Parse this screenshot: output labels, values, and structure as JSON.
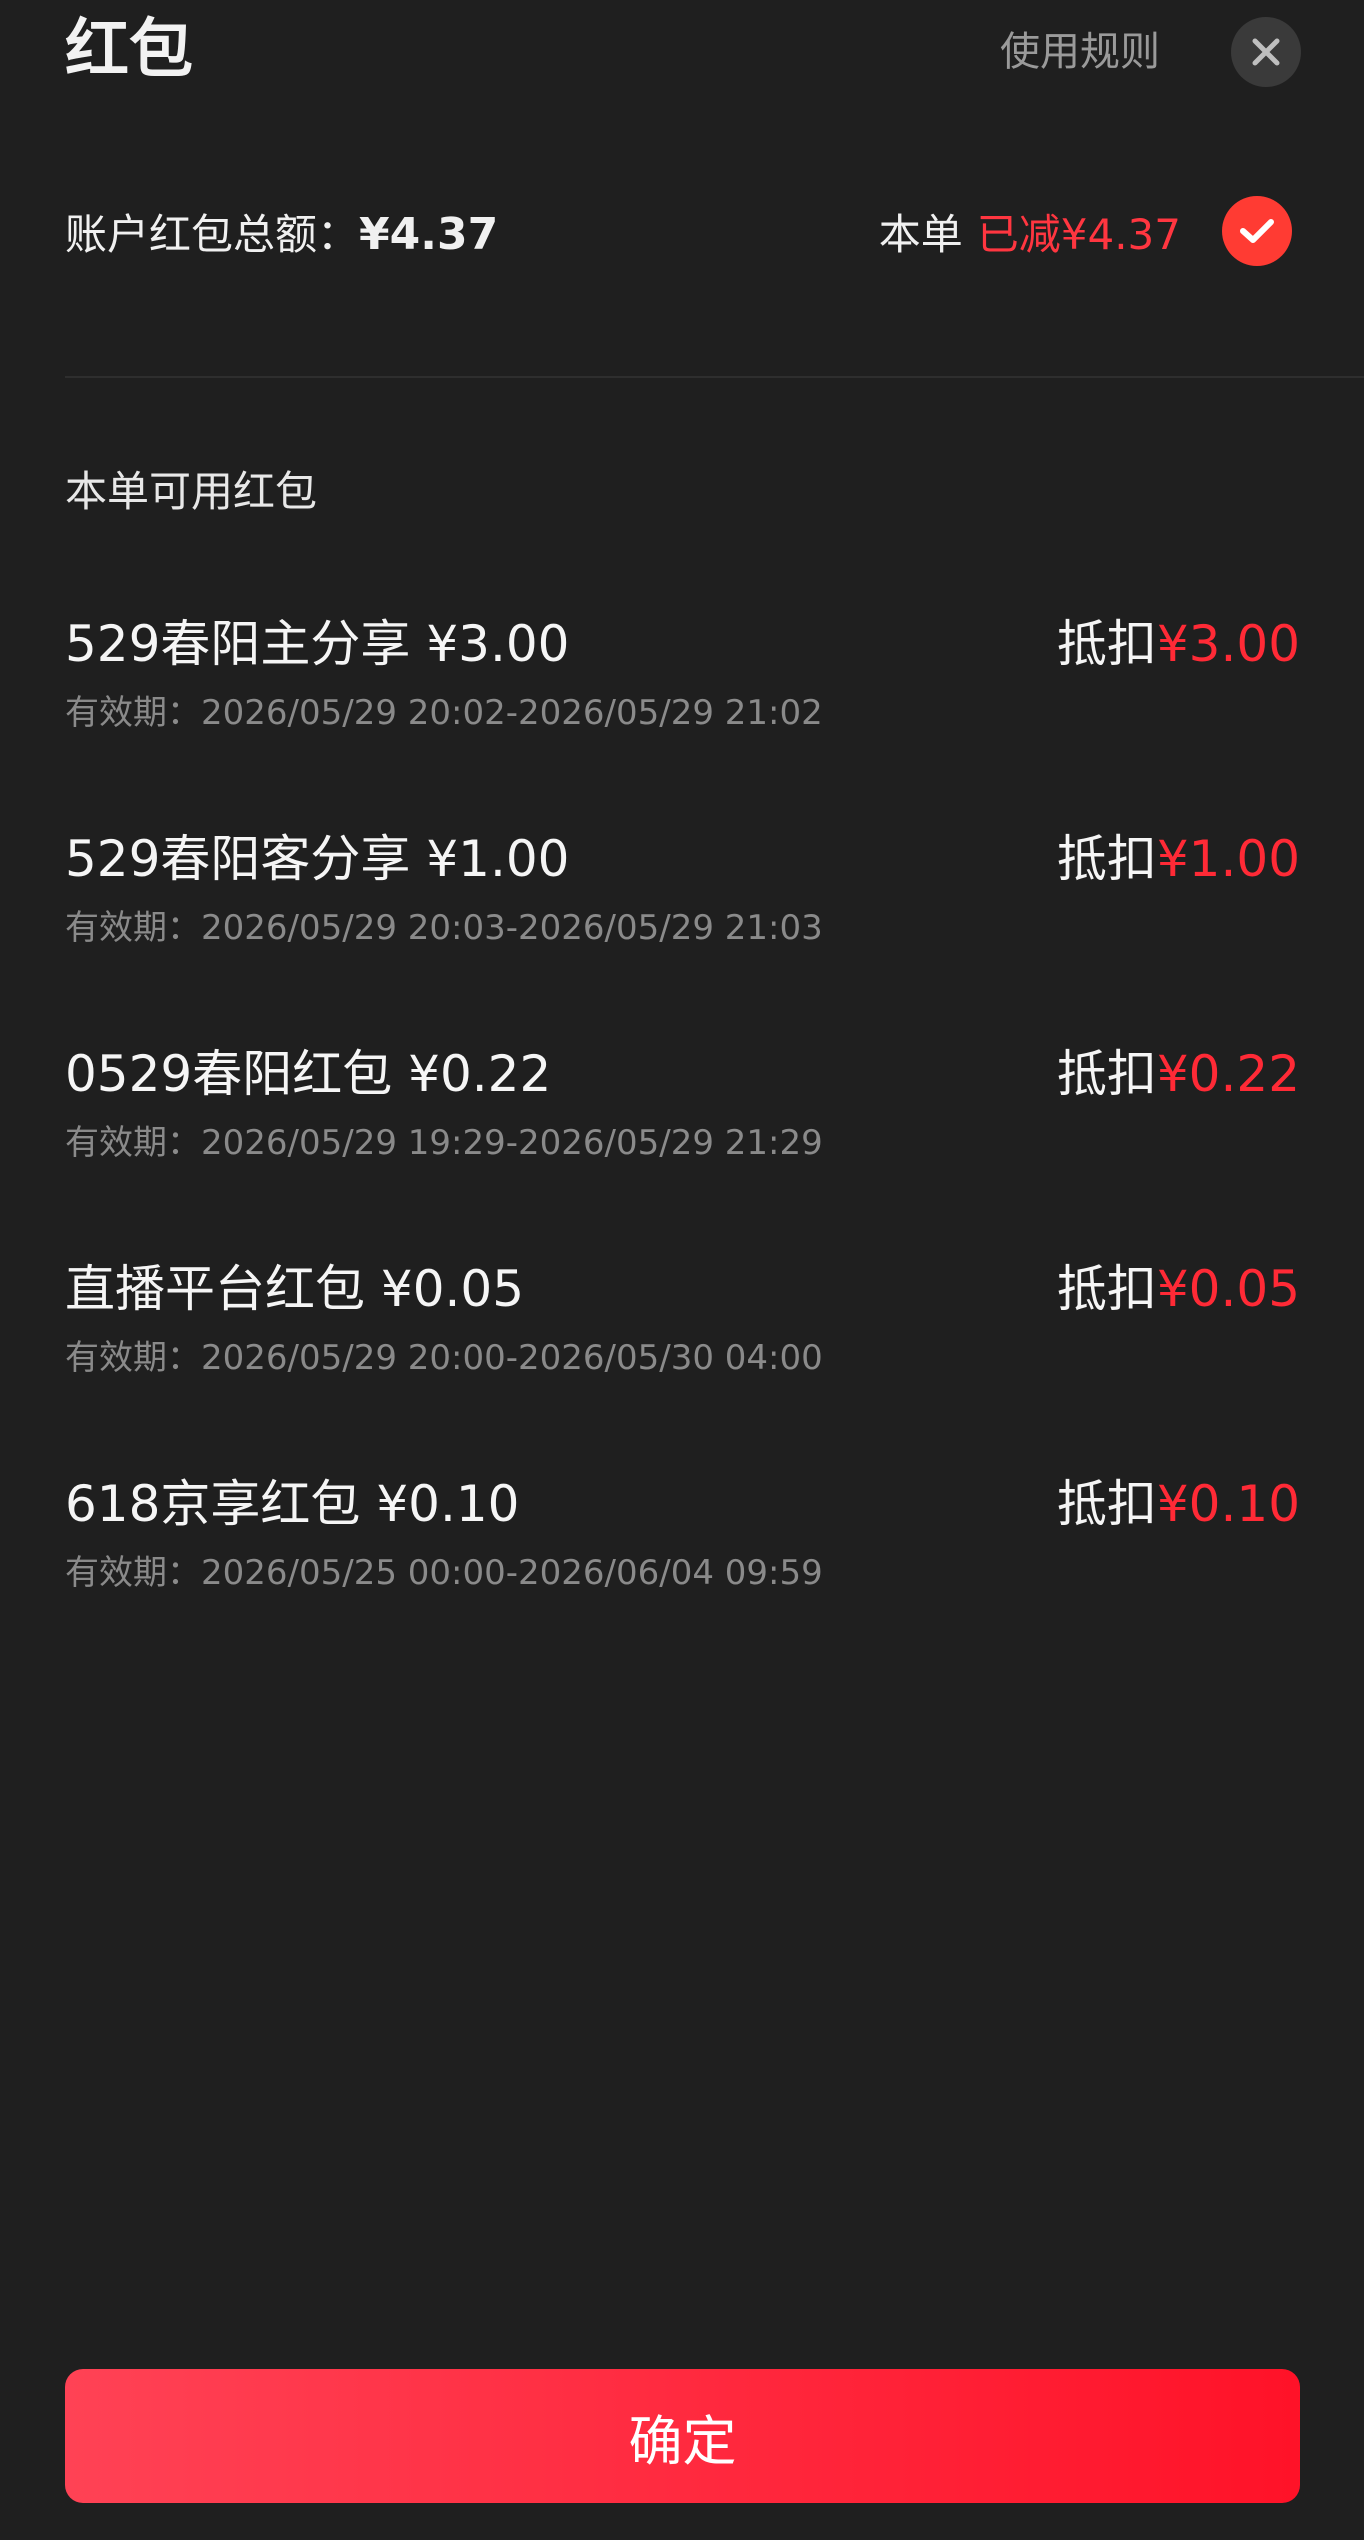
{
  "header": {
    "title": "红包",
    "rules_label": "使用规则"
  },
  "summary": {
    "total_label": "账户红包总额：",
    "total_amount": "¥4.37",
    "this_order_label": "本单",
    "reduced_text": "已减¥4.37",
    "selected": true
  },
  "section_title": "本单可用红包",
  "coupons": [
    {
      "name": "529春阳主分享 ¥3.00",
      "validity": "有效期：2026/05/29 20:02-2026/05/29 21:02",
      "deduct_label": "抵扣",
      "deduct_amount": "¥3.00"
    },
    {
      "name": "529春阳客分享 ¥1.00",
      "validity": "有效期：2026/05/29 20:03-2026/05/29 21:03",
      "deduct_label": "抵扣",
      "deduct_amount": "¥1.00"
    },
    {
      "name": "0529春阳红包 ¥0.22",
      "validity": "有效期：2026/05/29 19:29-2026/05/29 21:29",
      "deduct_label": "抵扣",
      "deduct_amount": "¥0.22"
    },
    {
      "name": "直播平台红包 ¥0.05",
      "validity": "有效期：2026/05/29 20:00-2026/05/30 04:00",
      "deduct_label": "抵扣",
      "deduct_amount": "¥0.05"
    },
    {
      "name": "618京享红包 ¥0.10",
      "validity": "有效期：2026/05/25 00:00-2026/06/04 09:59",
      "deduct_label": "抵扣",
      "deduct_amount": "¥0.10"
    }
  ],
  "confirm_label": "确定",
  "icons": {
    "close": "close-icon",
    "check": "check-icon"
  },
  "colors": {
    "background": "#1f1f1f",
    "accent_red": "#ff2a36",
    "check_bg": "#ff3b33",
    "button_gradient_start": "#ff4255",
    "button_gradient_end": "#ff1228"
  }
}
